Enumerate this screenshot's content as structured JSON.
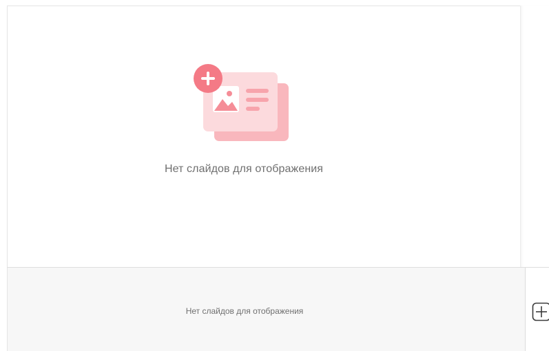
{
  "main": {
    "empty_message": "Нет слайдов для отображения",
    "illustration_icon": "add-slide-illustration-icon"
  },
  "thumbnails": {
    "empty_message": "Нет слайдов для отображения",
    "add_button_icon": "add-square-icon"
  },
  "colors": {
    "illustration_back": "#f9b7bd",
    "illustration_front": "#fcdadd",
    "illustration_accent": "#f58d97",
    "plus_badge": "#f47a86",
    "text": "#6f6f6f",
    "panel_bg": "#f7f7f7"
  }
}
